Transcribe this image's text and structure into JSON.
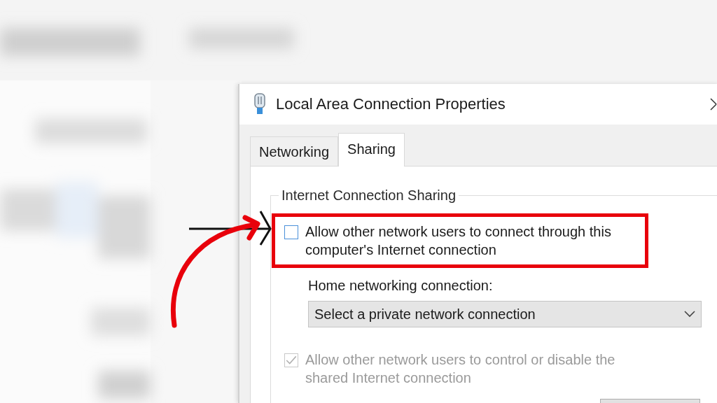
{
  "window": {
    "title": "Local Area Connection Properties"
  },
  "tabs": [
    {
      "label": "Networking",
      "selected": false
    },
    {
      "label": "Sharing",
      "selected": true
    }
  ],
  "sharing": {
    "group_title": "Internet Connection Sharing",
    "allow_connect": {
      "label": "Allow other network users to connect through this\ncomputer's Internet connection",
      "checked": false,
      "disabled": false,
      "highlighted": true
    },
    "home_label": "Home networking connection:",
    "home_connection": {
      "value": "Select a private network connection"
    },
    "allow_control": {
      "label": "Allow other network users to control or disable the\nshared Internet connection",
      "checked": true,
      "disabled": true
    }
  }
}
